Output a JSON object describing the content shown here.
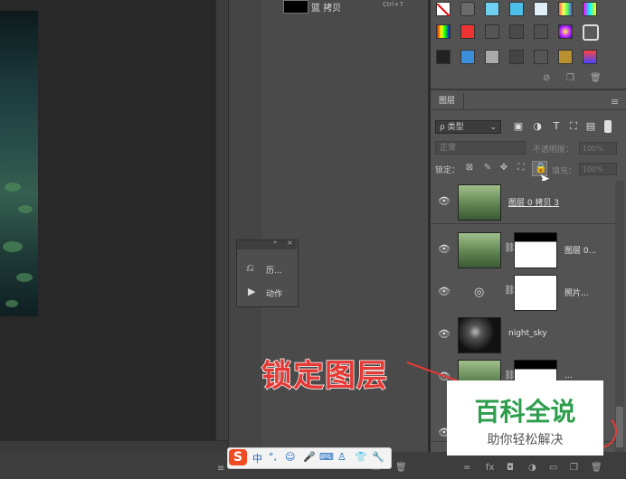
{
  "history": {
    "item_label": "拷贝",
    "item_shortcut": "Ctrl+7",
    "item_prefix": "篮"
  },
  "layers_panel": {
    "tab_label": "图层",
    "filter_label": "ρ 类型",
    "blend_mode": "正常",
    "opacity_label": "不透明度：",
    "opacity_value": "100%",
    "lock_label": "锁定：",
    "fill_label": "填充：",
    "fill_value": "100%",
    "layers": [
      {
        "name": "图层 0 拷贝 3"
      },
      {
        "name": "图层 0..."
      },
      {
        "name": "照片..."
      },
      {
        "name": "night_sky"
      },
      {
        "name": "..."
      }
    ]
  },
  "actions_panel": {
    "history_label": "历...",
    "actions_label": "动作"
  },
  "callout": {
    "text": "锁定图层",
    "color": "#e53935"
  },
  "watermark": {
    "title": "百科全说",
    "subtitle": "助你轻松解决"
  },
  "ime": {
    "items": [
      "中",
      "°,",
      "☺",
      "🎤",
      "⌨",
      "♙",
      "👕",
      "🔧"
    ]
  }
}
